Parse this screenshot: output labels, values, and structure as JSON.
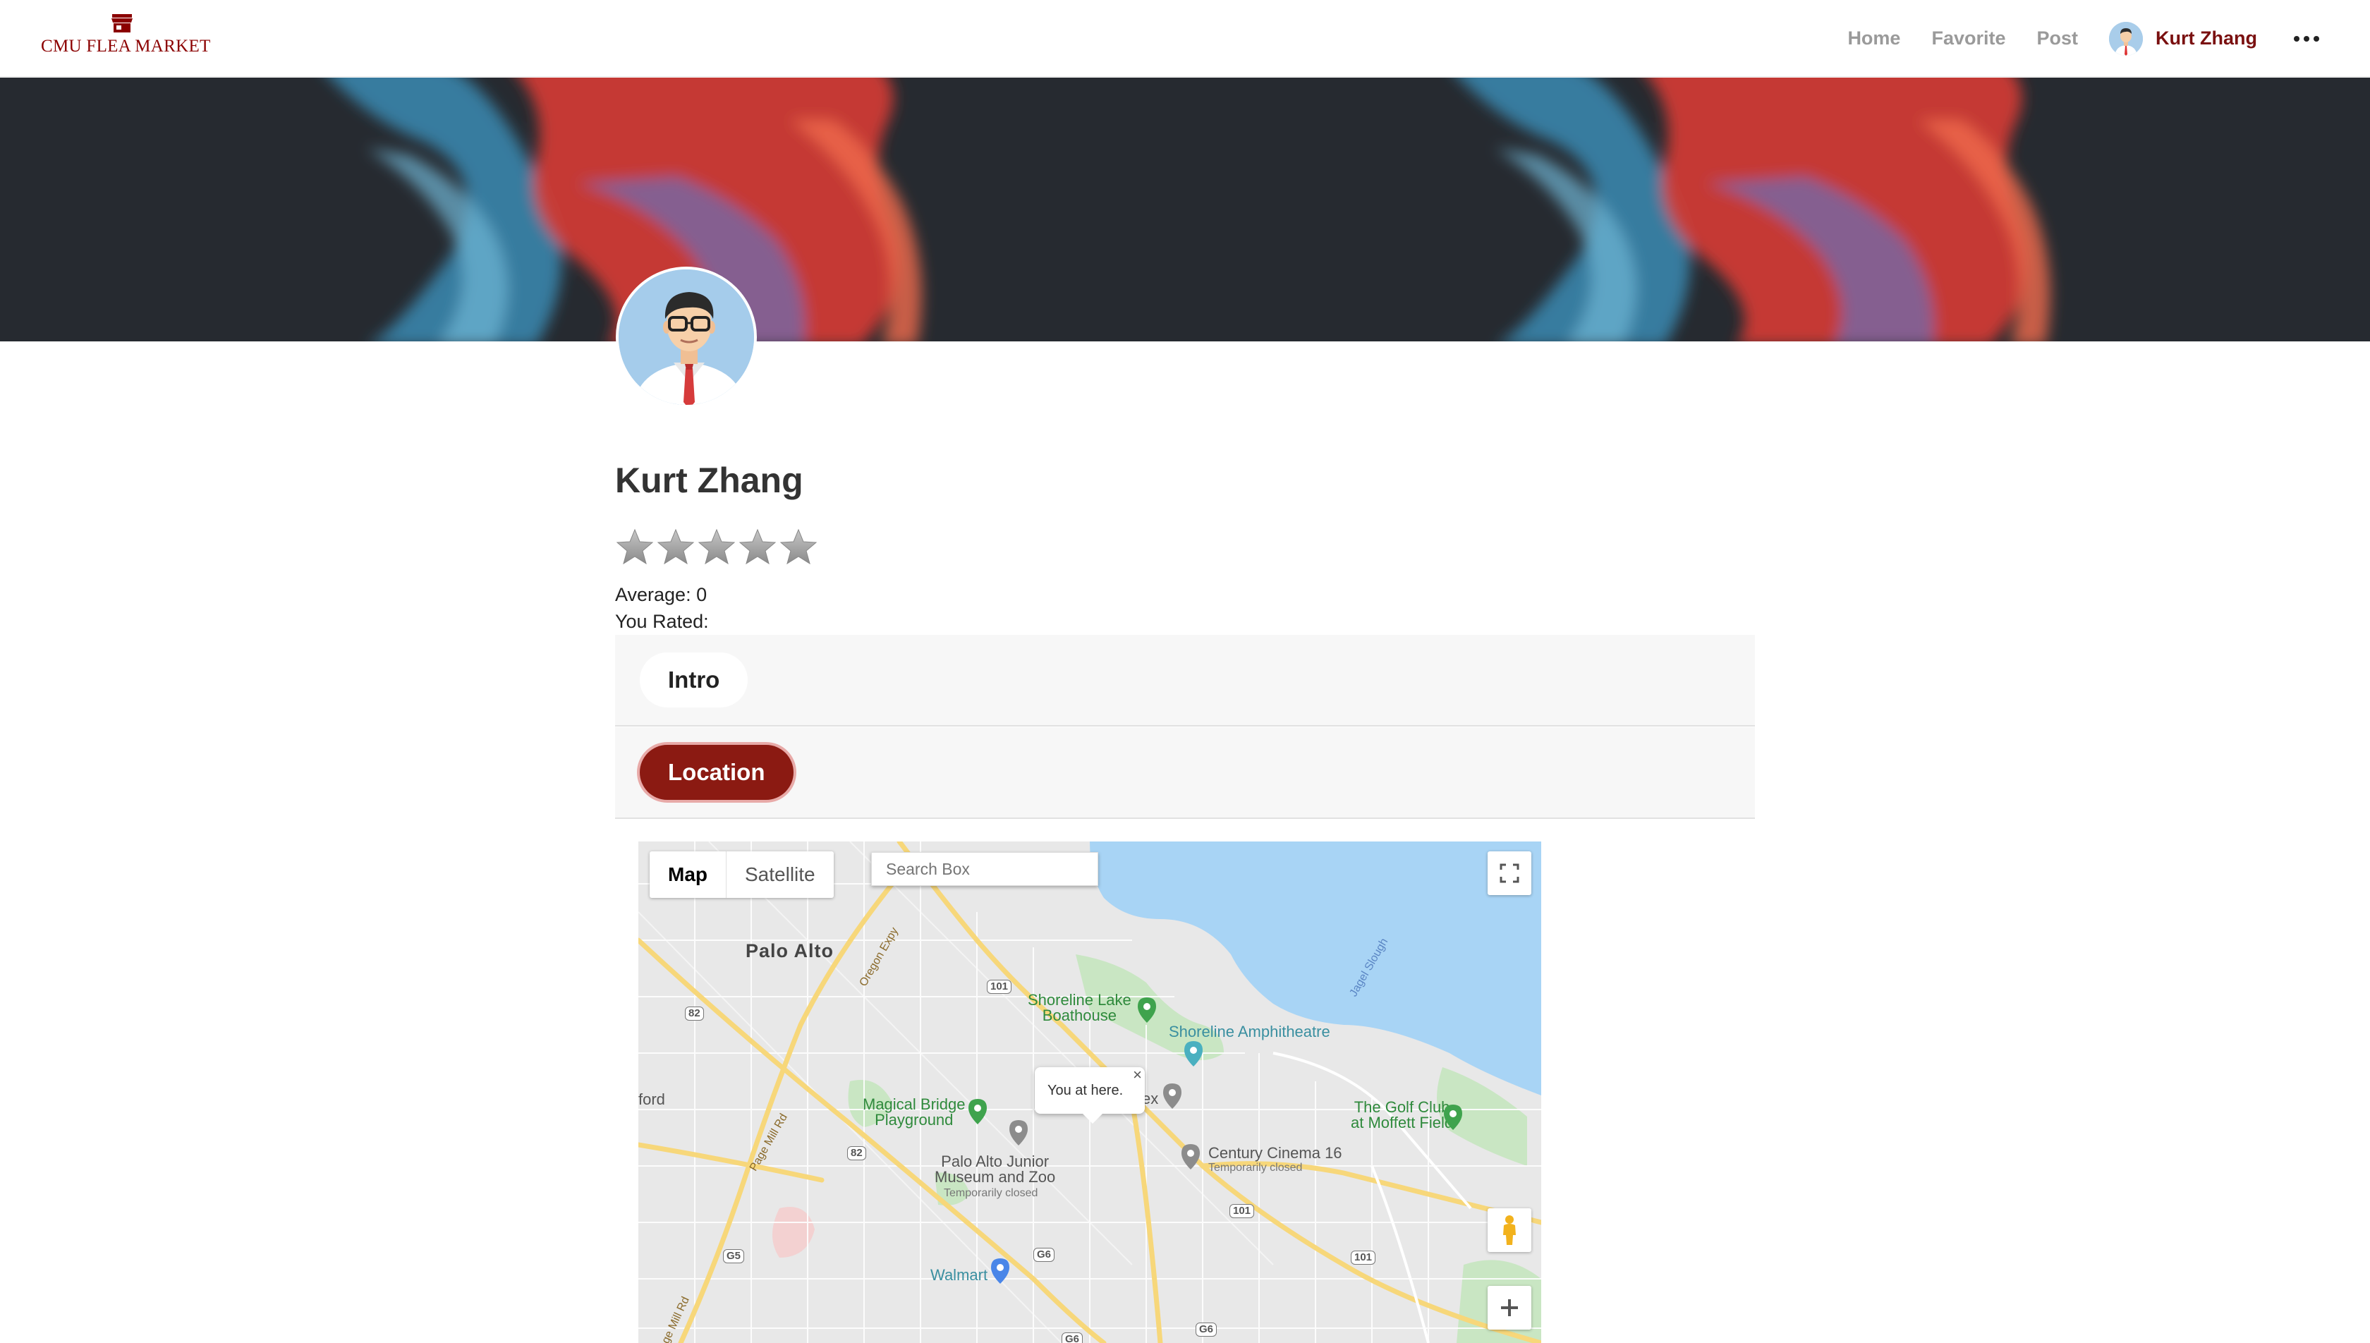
{
  "nav": {
    "brand": "CMU FLEA MARKET",
    "links": [
      "Home",
      "Favorite",
      "Post"
    ],
    "username": "Kurt Zhang",
    "more_icon": "more-horizontal-icon"
  },
  "profile": {
    "name": "Kurt Zhang",
    "rating_stars": 5,
    "rating_value": 0,
    "average": "Average: 0",
    "you_rated": "You Rated:"
  },
  "tabs": {
    "intro": "Intro",
    "location": "Location"
  },
  "map": {
    "type_map": "Map",
    "type_satellite": "Satellite",
    "search_placeholder": "Search Box",
    "info_window": "You at here.",
    "info_close": "×",
    "labels": {
      "palo_alto": "Palo Alto",
      "shoreline_lake": "Shoreline Lake\nBoathouse",
      "shoreline_amph": "Shoreline Amphitheatre",
      "golf": "The Golf Club\nat Moffett Field",
      "magical": "Magical Bridge\nPlayground",
      "junior": "Palo Alto Junior\nMuseum and Zoo",
      "junior_sub": "Temporarily closed",
      "century": "Century Cinema 16",
      "century_sub": "Temporarily closed",
      "walmart": "Walmart",
      "ford": "ford",
      "ex": "ex",
      "oregon": "Oregon Expy",
      "page_mill": "Page Mill Rd",
      "page_mill2": "ge Mill Rd",
      "jagel": "Jagel Slough"
    },
    "shields": [
      "101",
      "82",
      "82",
      "101",
      "101",
      "G6",
      "G5",
      "G6",
      "G6"
    ]
  },
  "colors": {
    "brand": "#8b0000",
    "accent": "#8b1a12",
    "water": "#a8d4f5"
  }
}
